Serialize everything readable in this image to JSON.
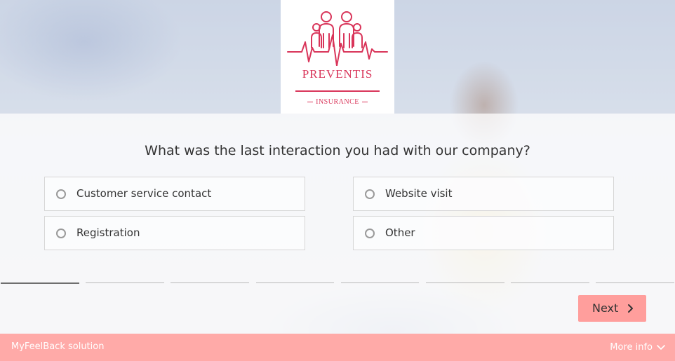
{
  "brand": {
    "name": "PREVENTIS",
    "tagline": "INSURANCE",
    "accent_color": "#d9355a"
  },
  "survey": {
    "question": "What was the last interaction you had with our company?",
    "options": [
      {
        "label": "Customer service contact",
        "selected": false
      },
      {
        "label": "Website visit",
        "selected": false
      },
      {
        "label": "Registration",
        "selected": false
      },
      {
        "label": "Other",
        "selected": false
      }
    ],
    "progress": {
      "steps": 8,
      "completed": 1
    },
    "next_label": "Next",
    "next_color": "#ff9e9c"
  },
  "footer": {
    "solution": "MyFeelBack solution",
    "more_info": "More info",
    "color": "#ffaaa8"
  },
  "icons": {
    "next": "chevron-right-icon",
    "more_info": "chevron-down-icon",
    "logo": "family-heartbeat-logo"
  }
}
